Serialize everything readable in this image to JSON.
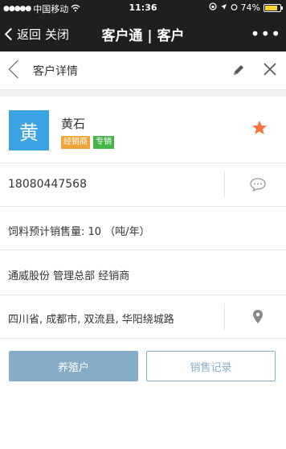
{
  "status_bar": {
    "carrier": "中国移动",
    "time": "11:36",
    "battery": "74%",
    "battery_level": 0.74
  },
  "nav": {
    "back_label": "返回",
    "close_label": "关闭",
    "title": "客户通 | 客户",
    "more": "•••"
  },
  "subheader": {
    "title": "客户详情"
  },
  "customer": {
    "avatar_char": "黄",
    "name": "黄石",
    "tags": [
      "经销商",
      "专销"
    ],
    "phone": "18080447568",
    "sales_volume": "饲料预计销售量:  10 （吨/年）",
    "organization": "通威股份 管理总部 经销商",
    "address": "四川省, 成都市, 双流县, 华阳绕城路"
  },
  "actions": {
    "primary": "养殖户",
    "secondary": "销售记录"
  },
  "colors": {
    "accent": "#3aa3e3",
    "star": "#f5733b",
    "button": "#85acc8",
    "tag_orange": "#f0a43a",
    "tag_green": "#44b549"
  }
}
